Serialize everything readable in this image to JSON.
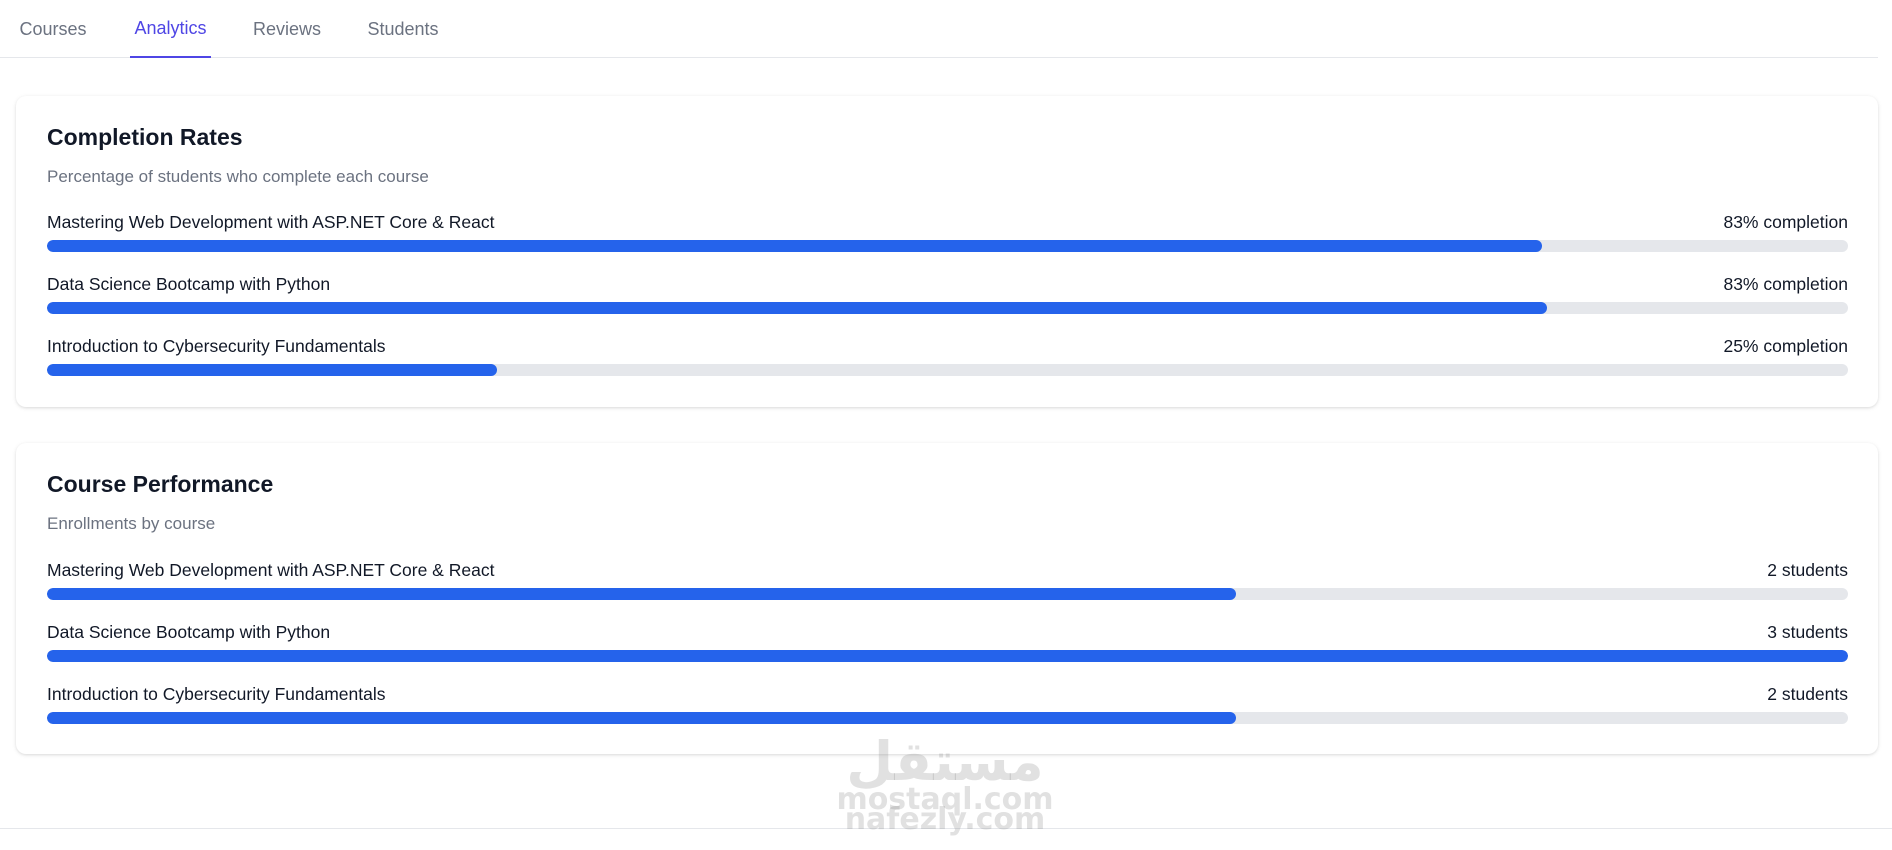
{
  "tabs": [
    {
      "label": "Courses",
      "active": false
    },
    {
      "label": "Analytics",
      "active": true
    },
    {
      "label": "Reviews",
      "active": false
    },
    {
      "label": "Students",
      "active": false
    }
  ],
  "completion": {
    "title": "Completion Rates",
    "subtitle": "Percentage of students who complete each course",
    "rows": [
      {
        "label": "Mastering Web Development with ASP.NET Core & React",
        "value": "83% completion",
        "progress": 0.83
      },
      {
        "label": "Data Science Bootcamp with Python",
        "value": "83% completion",
        "progress": 0.833
      },
      {
        "label": "Introduction to Cybersecurity Fundamentals",
        "value": "25% completion",
        "progress": 0.25
      }
    ]
  },
  "performance": {
    "title": "Course Performance",
    "subtitle": "Enrollments by course",
    "rows": [
      {
        "label": "Mastering Web Development with ASP.NET Core & React",
        "value": "2 students",
        "progress": 0.66
      },
      {
        "label": "Data Science Bootcamp with Python",
        "value": "3 students",
        "progress": 1.0
      },
      {
        "label": "Introduction to Cybersecurity Fundamentals",
        "value": "2 students",
        "progress": 0.66
      }
    ]
  },
  "watermark": {
    "arabic": "مستقل",
    "line1": "mostaql.com",
    "line2": "nafezly.com"
  },
  "colors": {
    "accent": "#4f46e5",
    "bar_fill": "#2563eb",
    "bar_track": "#e5e7eb"
  }
}
